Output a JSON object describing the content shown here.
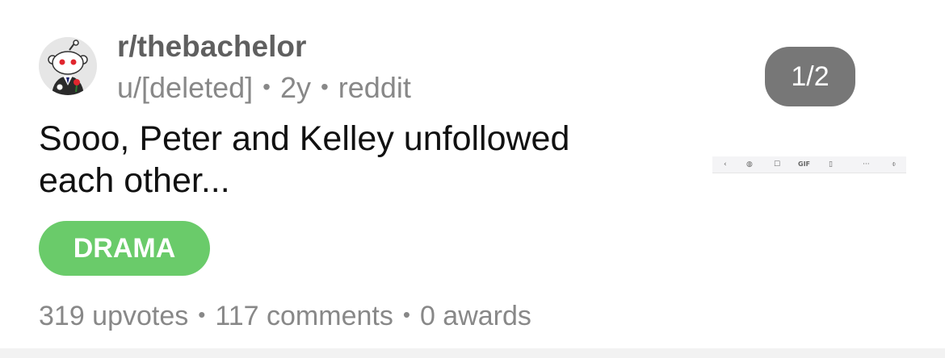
{
  "post": {
    "subreddit": "r/thebachelor",
    "author": "u/[deleted]",
    "age": "2y",
    "source": "reddit",
    "separator": "•",
    "title": "Sooo, Peter and Kelley unfollowed each other...",
    "flair": {
      "label": "DRAMA",
      "color": "#6acb6a"
    },
    "stats": {
      "upvotes": "319 upvotes",
      "comments": "117 comments",
      "awards": "0 awards"
    },
    "media": {
      "page_indicator": "1/2",
      "thumbnail_toolbar": {
        "icons": [
          "back-chevron-icon",
          "palette-icon",
          "sticker-icon",
          "gif-icon",
          "clipboard-icon",
          "more-icon",
          "microphone-icon"
        ],
        "gif_label": "GIF"
      }
    },
    "avatar": {
      "icon": "reddit-snoo-avatar-icon"
    }
  },
  "colors": {
    "flair": "#6acb6a",
    "badge_bg": "#777777",
    "meta_text": "#888888",
    "title_text": "#111111",
    "subreddit_text": "#5f5f5f"
  }
}
